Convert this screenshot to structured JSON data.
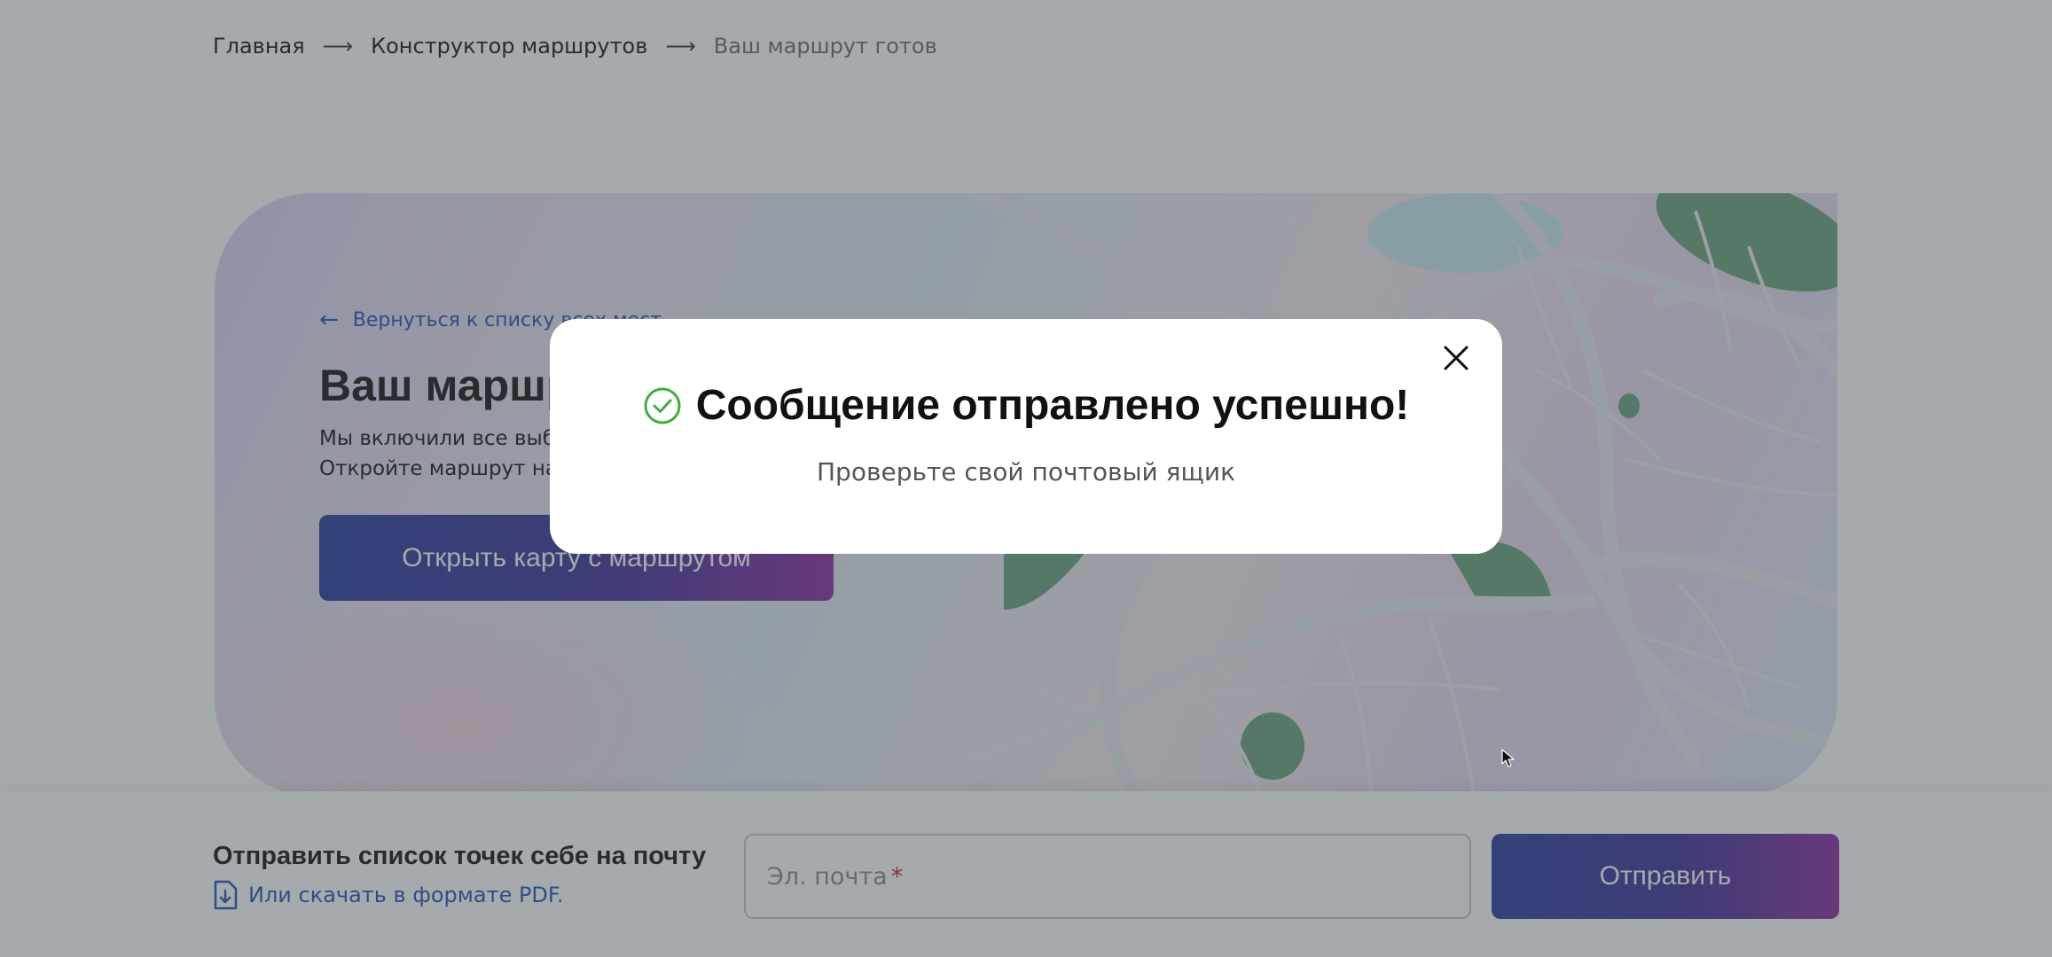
{
  "breadcrumb": {
    "items": [
      "Главная",
      "Конструктор маршрутов",
      "Ваш маршрут готов"
    ],
    "separator": "⟶"
  },
  "hero": {
    "back_link": "Вернуться к списку всех мест",
    "title": "Ваш маршрут готов!",
    "description": "Мы включили все выбранные места в маршрут. Откройте маршрут на Яндекс Картах",
    "open_map_button": "Открыть карту с маршрутом"
  },
  "bottom": {
    "title": "Отправить список точек себе на почту",
    "pdf_link": "Или скачать в формате PDF.",
    "email_placeholder": "Эл. почта",
    "required_mark": "*",
    "send_button": "Отправить"
  },
  "modal": {
    "title": "Сообщение отправлено успешно!",
    "subtitle": "Проверьте свой почтовый ящик"
  },
  "colors": {
    "accent_blue": "#2350b8",
    "button_gradient_start": "#2a3a9e",
    "button_gradient_end": "#8a2aa3",
    "success_green": "#3fae3f",
    "required_red": "#d0201f",
    "overlay": "rgba(64,74,80,0.47)"
  },
  "icons": [
    "arrow-left-icon",
    "document-download-icon",
    "check-circle-icon",
    "close-icon",
    "mouse-cursor-icon"
  ]
}
